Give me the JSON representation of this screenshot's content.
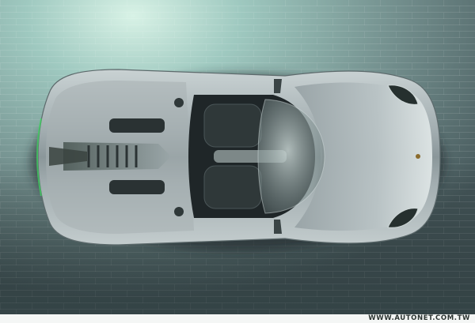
{
  "photo": {
    "subject": "sports-car-top-view",
    "palette": {
      "background_light": "#9fc9c0",
      "background_dark": "#4a5d60",
      "body_silver": "#a9b4b7",
      "body_shadow": "#5c686d",
      "interior_dark": "#1f2628"
    }
  },
  "watermark": {
    "text": "WWW.AUTONET.COM.TW"
  }
}
